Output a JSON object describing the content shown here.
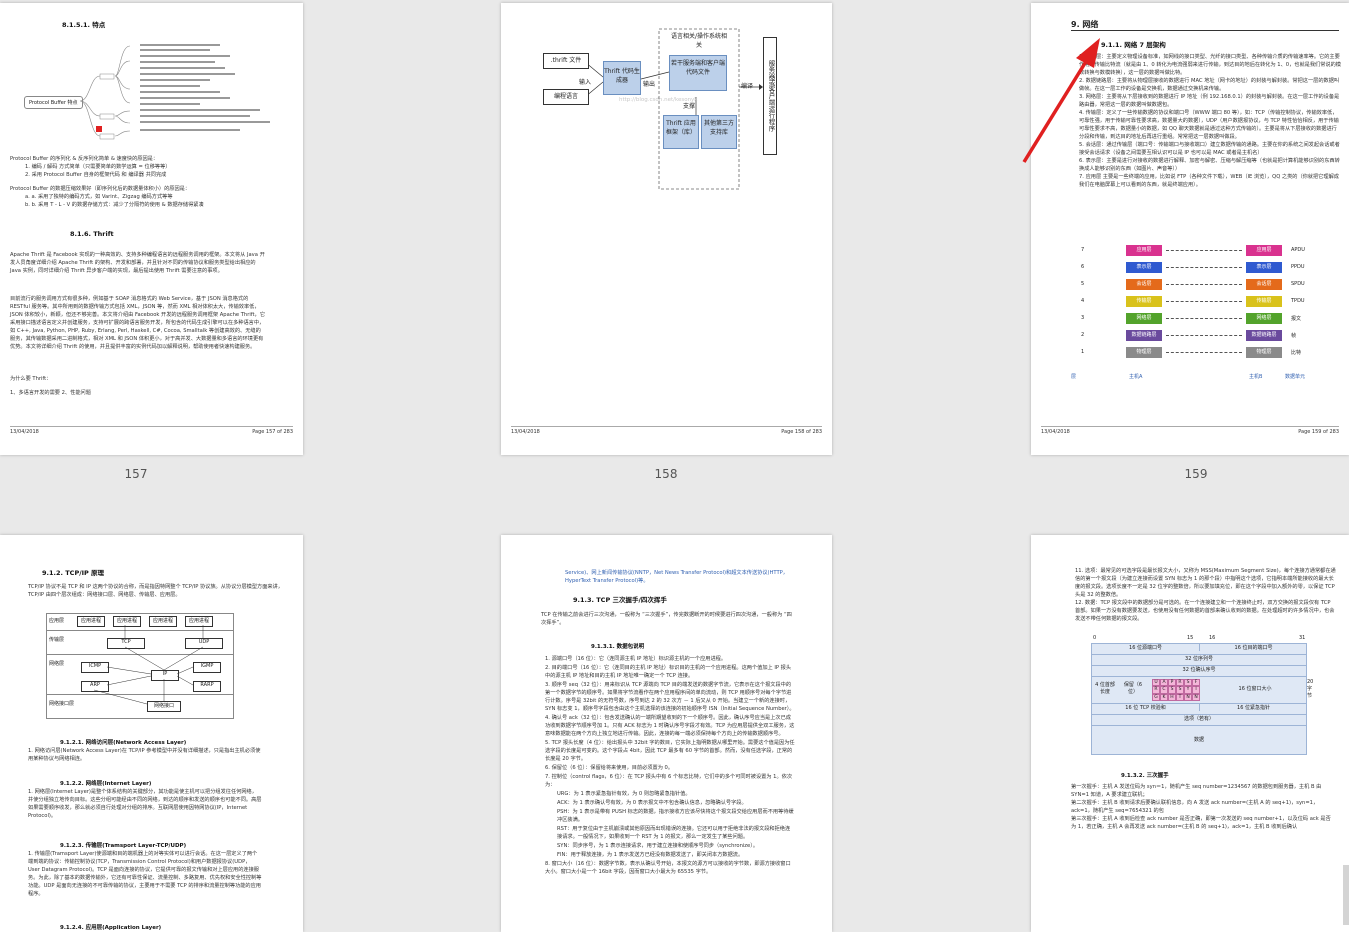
{
  "page_numbers": [
    "157",
    "158",
    "159"
  ],
  "p157": {
    "section": "8.1.5.1.   特点",
    "mindmap_root": "Protocol Buffer 特点",
    "lines": [
      "Protocol Buffer 的序列化 & 反序列化简单 & 速度快的原因是：",
      "1.  编码 / 解码 方式简单（只需要简单的数学运算 = 位移等等）",
      "2.  采用 Protocol Buffer 自身的框架代码 和 编译器 共同完成",
      "Protocol Buffer 的数据压缩效果好（即序列化后的数据量体积小）的原因是：",
      "a.  a. 采用了独特的编码方式，如 Varint、Zigzag 编码方式等等",
      "b.  b. 采用 T - L - V 的数据存储方式：减少了分隔符的使用 & 数据存储得紧凑"
    ],
    "thrift_heading": "8.1.6.   Thrift",
    "para1": "Apache Thrift 是 Facebook 实现的一种高效的、支持多种编程语言的远程服务调用的框架。本文将从 Java 开发人员角度详细介绍 Apache Thrift 的架构、开发和部署，并且针对不同的传输协议和服务类型给出相应的 Java 实例，同时详细介绍 Thrift 异步客户端的实现，最后提出使用 Thrift 需要注意的事项。",
    "para2": "目前流行的服务调用方式有很多种，例如基于 SOAP 消息格式的 Web Service，基于 JSON 消息格式的 RESTful 服务等。其中所用到的数据传输方式包括 XML，JSON 等，然而 XML 相对体积太大，传输效率低，JSON 体积较小，新颖，但还不够完善。本文将介绍由 Facebook 开发的远程服务调用框架 Apache Thrift，它采用接口描述语言定义并创建服务，支持可扩展的跨语言服务开发，所包含的代码生成引擎可以在多种语言中，如 C++, Java, Python, PHP, Ruby, Erlang, Perl, Haskell, C#, Cocoa, Smalltalk 等创建高效的、无缝的服务，其传输数据采用二进制格式，相对 XML 和 JSON 体积更小，对于高并发、大数据量和多语言的环境更有优势。本文将详细介绍 Thrift 的使用，并且提供丰富的实例代码加以解释说明，帮助使用者快速构建服务。",
    "why": "为什么要 Thrift：",
    "why_item": "1、多语言开发的需要 2、性能问题",
    "footer_left": "13/04/2018",
    "footer_right": "Page 157 of 283"
  },
  "p158": {
    "thrift_file": ".thrift 文件",
    "input": "输入",
    "gen": "Thrift 代码生成器",
    "output": "输出",
    "lang_top": "语言相关/操作系统相关",
    "frame_code": "若干服务端和客户端代码文件",
    "support": "支撑",
    "lib": "Thrift 应用框架（库）",
    "third": "其他第三方支持库",
    "compile": "编译",
    "prog_lang": "编程语言",
    "watermark": "http://blog.csdn.net/kesonyk",
    "runtime": "服务器或客户端运行程序",
    "footer_left": "13/04/2018",
    "footer_right": "Page 158 of 283"
  },
  "p159": {
    "chapter": "9.  网络",
    "section": "9.1.1.  网络 7 层架构",
    "items": [
      "1.  物理层：主要定义物理设备标准，如网线的接口类型、光纤的接口类型、各种传输介质的传输速率等。它的主要作用是传输比特流（就是由 1、0 转化为电流强弱来进行传输，到达目的地后在转化为 1、0，也就是我们常说的模数转换与数模转换），这一层的数据叫做比特。",
      "2.  数据链路层：主要将从物理层接收的数据进行 MAC 地址（网卡的地址）的封装与解封装。常把这一层的数据叫做帧。在这一层工作的设备是交换机，数据通过交换机来传输。",
      "3.  网络层：主要将从下层接收到的数据进行 IP 地址（例 192.168.0.1）的封装与解封装。在这一层工作的设备是路由器，常把这一层的数据叫做数据包。",
      "4.  传输层：定义了一些传输数据的协议和端口号（WWW 端口 80 等），如：TCP（传输控制协议，传输效率低，可靠性强，用于传输可靠性要求高，数据量大的数据），UDP（用户数据报协议，与 TCP 特性恰恰相反，用于传输可靠性要求不高，数据量小的数据，如 QQ 聊天数据就是通过这种方式传输的）。主要是将从下层接收的数据进行分段和传输，到达目的地址后再进行重组。常常把这一层数据叫做段。",
      "5.  会话层：通过传输层（端口号：传输端口与接收端口）建立数据传输的通路。主要在你的系统之间发起会话或者接受会话请求（设备之间需要互相认识可以是 IP 也可以是 MAC 或者是主机名）",
      "6.  表示层：主要是进行对接收的数据进行解释、加密与解密、压缩与解压缩等（也就是把计算机能够识别的东西转换成人能够识别的东西（如图片、声音等））",
      "7.  应用层 主要是一些终端的应用，比如说 FTP（各种文件下载），WEB（IE 浏览），QQ 之类的（你就把它理解成我们在电脑屏幕上可以看到的东西，就是终端应用）。"
    ],
    "layer_nums": [
      "7",
      "6",
      "5",
      "4",
      "3",
      "2",
      "1"
    ],
    "layer_names": [
      "应用层",
      "表示层",
      "会话层",
      "传输层",
      "网络层",
      "数据链路层",
      "物理层"
    ],
    "proto_units": [
      "APDU",
      "PPDU",
      "SPDU",
      "TPDU",
      "报文",
      "帧",
      "比特"
    ],
    "bottom_labels": [
      "层",
      "主机A",
      "主机B",
      "数据单元"
    ],
    "footer_left": "13/04/2018",
    "footer_right": "Page 159 of 283"
  },
  "p_tcpip": {
    "section": "9.1.2.  TCP/IP 原理",
    "intro": "TCP/IP 协议不是 TCP 和 IP 这两个协议的合称，而是指因特网整个 TCP/IP 协议族。从协议分层模型方面来讲，TCP/IP 由四个层次组成：网络接口层、网络层、传输层、应用层。",
    "layers": [
      "应用层",
      "传输层",
      "网络层",
      "网络接口层"
    ],
    "app_protocols": [
      "应用进程",
      "应用进程",
      "应用进程",
      "应用进程"
    ],
    "transport": [
      "TCP",
      "UDP"
    ],
    "network": [
      "ICMP",
      "IP",
      "IGMP",
      "ARP",
      "RARP"
    ],
    "iface": "网络接口",
    "s1": "9.1.2.1.   网络访问层(Network Access Layer)",
    "s1_text": "1.  网络访问层(Network Access Layer)在 TCP/IP 参考模型中并没有详细描述，只是指出主机必须使用某种协议与网络相连。",
    "s2": "9.1.2.2.   网络层(Internet Layer)",
    "s2_text": "1.  网络层(Internet Layer)是整个体系结构的关键部分，其功能是使主机可以把分组发往任何网络，并使分组独立地传向目标。这些分组可能经由不同的网络，到达的顺序和发送的顺序也可能不同。高层如果需要顺序收发，那么就必须自行处理对分组的排序。互联网层使用因特网协议(IP，Internet Protocol)。",
    "s3": "9.1.2.3.   传输层(Tramsport Layer-TCP/UDP)",
    "s3_text": "1.  传输层(Tramsport Layer)使源端和目的端机器上的对等实体可以进行会话。在这一层定义了两个端到端的协议：传输控制协议(TCP，Transmission Control Protocol)和用户数据报协议(UDP，User Datagram Protocol)。TCP 是面向连接的协议，它提供可靠的报文传输和对上层应用的连接服务。为此，除了基本的数据传输外，它还有可靠性保证、流量控制、多路复用、优先权和安全性控制等功能。UDP 是面向无连接的不可靠传输的协议，主要用于不需要 TCP 的排序和流量控制等功能的应用程序。",
    "s4": "9.1.2.4.   应用层(Application Layer)"
  },
  "p_tcp": {
    "top_text": "Service)、网上新闻传输协议(NNTP，Net News Transfer Protocol)和超文本传送协议(HTTP，HyperText Transfer Protocol)等。",
    "section": "9.1.3.  TCP 三次握手/四次挥手",
    "intro": "TCP 在传输之前会进行三次沟通，一般称为 “三次握手”，传完数据断开的时候要进行四次沟通，一般称为 “四次挥手”。",
    "sub": "9.1.3.1.   数据包说明",
    "fields": [
      "1.  源端口号（16 位）：它（连同源主机 IP 地址）标识源主机的一个应用进程。",
      "2.  目的端口号（16 位）：它（连同目的主机 IP 地址）标识目的主机的一个应用进程。这两个值加上 IP 报头中的源主机 IP 地址和目的主机 IP 地址唯一确定一个 TCP 连接。",
      "3.  顺序号 seq（32 位）：用来标识从 TCP 源端向 TCP 目的端发送的数据字节流，它表示在这个报文段中的第一个数据字节的顺序号。如果将字节流看作在两个应用程序间的单向流动，则 TCP 用顺序号对每个字节进行计数。序号是 32bit 的无符号数，序号到达 2 的 32 次方 － 1 后又从 0 开始。当建立一个新的连接时，SYN 标志变 1，顺序号字段包含由这个主机选择的该连接的初始顺序号 ISN（Initial Sequence Number）。",
      "4.  确认号 ack（32 位）：包含发送确认的一端所期望收到的下一个顺序号。因此，确认序号应当是上次已成功收到数据字节顺序号加 1。只有 ACK 标志为 1 时确认序号字段才有效。TCP 为应用层提供全双工服务，这意味数据能在两个方向上独立地进行传输。因此，连接的每一端必须保持每个方向上的传输数据顺序号。",
      "5.  TCP 报头长度（4 位）：给出报头中 32bit 字的数目，它实际上指明数据从哪里开始。需要这个值是因为任选字段的长度是可变的。这个字段占 4bit，因此 TCP 最多有 60 字节的首部。然而，没有任选字段，正常的长度是 20 字节。",
      "6.  保留位（6 位）：保留给将来使用，目前必须置为 0。",
      "7.  控制位（control flags，6 位）：在 TCP 报头中有 6 个标志比特，它们中的多个可同时被设置为 1。依次为：",
      "URG：为 1 表示紧急指针有效，为 0 则忽略紧急指针值。",
      "ACK：为 1 表示确认号有效，为 0 表示报文中不包含确认信息，忽略确认号字段。",
      "PSH：为 1 表示是带有 PUSH 标志的数据，指示接收方应该尽快将这个报文段交给应用层而不用等待缓冲区装满。",
      "RST：用于复位由于主机崩溃或其他原因而出现错误的连接。它还可以用于拒绝非法的报文段和拒绝连接请求。一般情况下，如果收到一个 RST 为 1 的报文，那么一定发生了某些问题。",
      "SYN：同步序号，为 1 表示连接请求，用于建立连接和使顺序号同步（synchronize）。",
      "FIN：用于释放连接，为 1 表示发送方已经没有数据发送了，即关闭本方数据流。",
      "8.  窗口大小（16 位）：数据字节数，表示从确认号开始，本报文的源方可以接收的字节数，即源方接收窗口大小。窗口大小是一个 16bit 字段，因而窗口大小最大为 65535 字节。"
    ]
  },
  "p_hs": {
    "items": [
      "11.  选项：最常见的可选字段是最长报文大小，又称为 MSS(Maximum Segment Size)，每个连接方通常都在通信的第一个报文段（为建立连接而设置 SYN 标志为 1 的那个段）中指明这个选项，它指明本端所能接收的最大长度的报文段。选项长度不一定是 32 位字的整数倍，所以要加填充位，即在这个字段中加入额外的零，以保证 TCP 头是 32 的整数倍。",
      "12.  数据：TCP 报文段中的数据部分是可选的。在一个连接建立和一个连接终止时，双方交换的报文段仅有 TCP 首部。如果一方没有数据要发送，也使用没有任何数据的首部来确认收到的数据。在处理超时的许多情况中，也会发送不带任何数据的报文段。"
    ],
    "diagram_top": [
      "0",
      "15",
      "16",
      "31"
    ],
    "rows": [
      "16 位源端口号",
      "16 位目的端口号",
      "32 位序列号",
      "32 位确认序号",
      "4 位首部长度",
      "保留（6 位）",
      "16 位窗口大小",
      "16 位 TCP 校验和",
      "16 位紧急指针",
      "选项（若有）",
      "数据"
    ],
    "flags": [
      "U",
      "A",
      "P",
      "R",
      "S",
      "F",
      "R",
      "C",
      "S",
      "S",
      "Y",
      "I",
      "G",
      "K",
      "H",
      "T",
      "N",
      "N"
    ],
    "bytes": "20 字节",
    "hs_heading": "9.1.3.2.   三次握手",
    "hs": [
      "第一次握手：主机 A 发送位码为 syn＝1，随机产生 seq number=1234567 的数据包到服务器，主机 B 由 SYN=1 知道，A 要求建立联机；",
      "第二次握手：主机 B 收到请求后要确认联机信息，向 A 发送 ack number=(主机 A 的 seq+1)，syn=1，ack=1，随机产生 seq=7654321 的包",
      "第三次握手：主机 A 收到后检查 ack number 是否正确，即第一次发送的 seq number+1，以及位码 ack 是否为 1，若正确，主机 A 会再发送 ack number=(主机 B 的 seq+1)，ack=1，主机 B 收到后确认"
    ]
  },
  "colors": {
    "background": "#e9e9e9",
    "page": "#ffffff",
    "annotation_red": "#e02020",
    "link_blue": "#2f5fb0",
    "layer_pink": "#d9328f",
    "layer_blue": "#2f5ad0",
    "layer_orange": "#e46a1b",
    "layer_yellow": "#d9c21b",
    "layer_green": "#53a32b",
    "layer_purple": "#6a4a9d",
    "layer_gray": "#8a8a8a"
  }
}
